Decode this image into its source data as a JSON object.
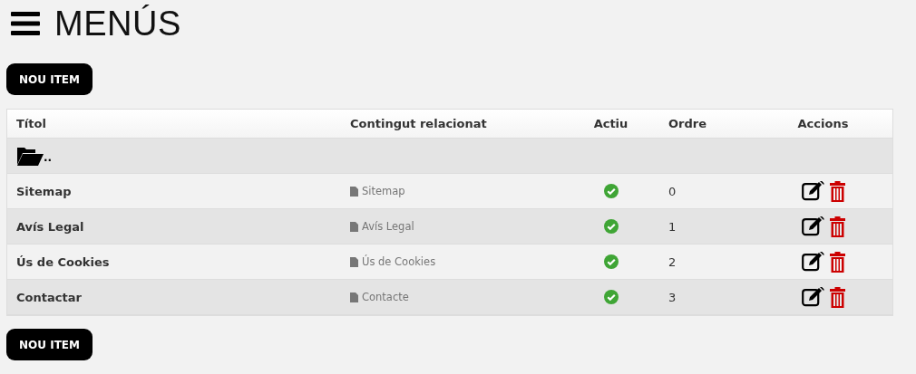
{
  "title": "MENÚS",
  "new_item_buttons": [
    "NOU ITEM",
    "NOU ITEM"
  ],
  "table": {
    "columns": [
      "Títol",
      "Contingut relacionat",
      "Actiu",
      "Ordre",
      "Accions"
    ],
    "parent_row": {
      "label": ".."
    },
    "rows": [
      {
        "title": "Sitemap",
        "content": "Sitemap",
        "active": true,
        "order": "0"
      },
      {
        "title": "Avís Legal",
        "content": "Avís Legal",
        "active": true,
        "order": "1"
      },
      {
        "title": "Ús de Cookies",
        "content": "Ús de Cookies",
        "active": true,
        "order": "2"
      },
      {
        "title": "Contactar",
        "content": "Contacte",
        "active": true,
        "order": "3"
      }
    ]
  }
}
